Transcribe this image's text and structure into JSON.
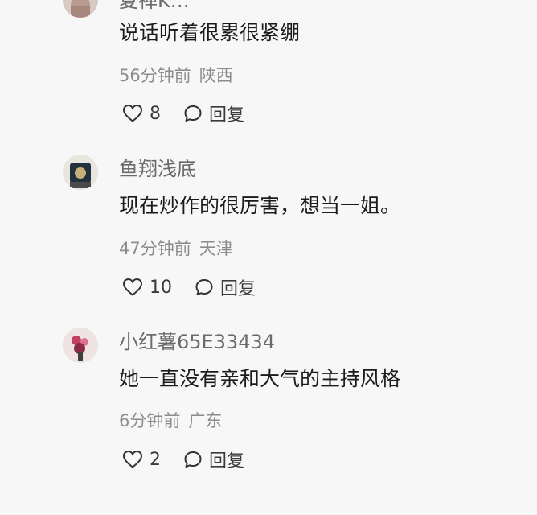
{
  "comments": [
    {
      "username": "夏禅K…",
      "content": "说话听着很累很紧绷",
      "time": "56分钟前",
      "location": "陕西",
      "likes": "8",
      "reply_label": "回复"
    },
    {
      "username": "鱼翔浅底",
      "content": "现在炒作的很厉害，想当一姐。",
      "time": "47分钟前",
      "location": "天津",
      "likes": "10",
      "reply_label": "回复"
    },
    {
      "username": "小红薯65E33434",
      "content": "她一直没有亲和大气的主持风格",
      "time": "6分钟前",
      "location": "广东",
      "likes": "2",
      "reply_label": "回复"
    }
  ],
  "icons": {
    "like": "heart-outline-icon",
    "reply": "speech-bubble-icon"
  }
}
